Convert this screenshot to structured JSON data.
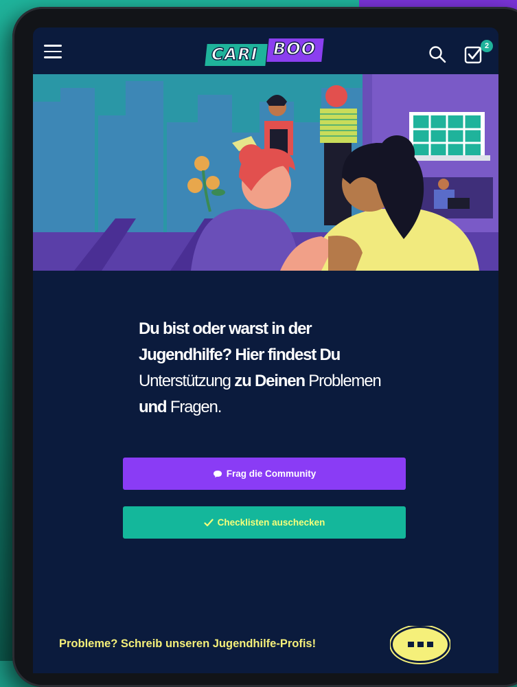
{
  "app": {
    "logo_left": "CARI",
    "logo_right": "BOO",
    "checklist_badge": "2"
  },
  "icons": {
    "menu": "hamburger-menu-icon",
    "search": "search-icon",
    "checklist": "checklist-icon",
    "community": "chat-bubble-icon",
    "checkmark": "checkmark-icon",
    "chat": "chat-ellipsis-icon"
  },
  "main": {
    "headline_parts": {
      "p1": "Du bist oder warst in der Jugendhilfe?",
      "p2": " Hier findest Du",
      "p3": " Unterstützung",
      "p4": " zu Deinen",
      "p5": " Problemen",
      "p6": " und",
      "p7": " Fragen."
    },
    "btn_community": "Frag die Community",
    "btn_checklist": "Checklisten auschecken",
    "contact_cta": "Probleme? Schreib unseren Jugendhilfe-Profis!"
  },
  "colors": {
    "background": "#0b1b3d",
    "accent_purple": "#8a3cf5",
    "accent_teal": "#14b79b",
    "accent_yellow": "#f5f07a"
  }
}
